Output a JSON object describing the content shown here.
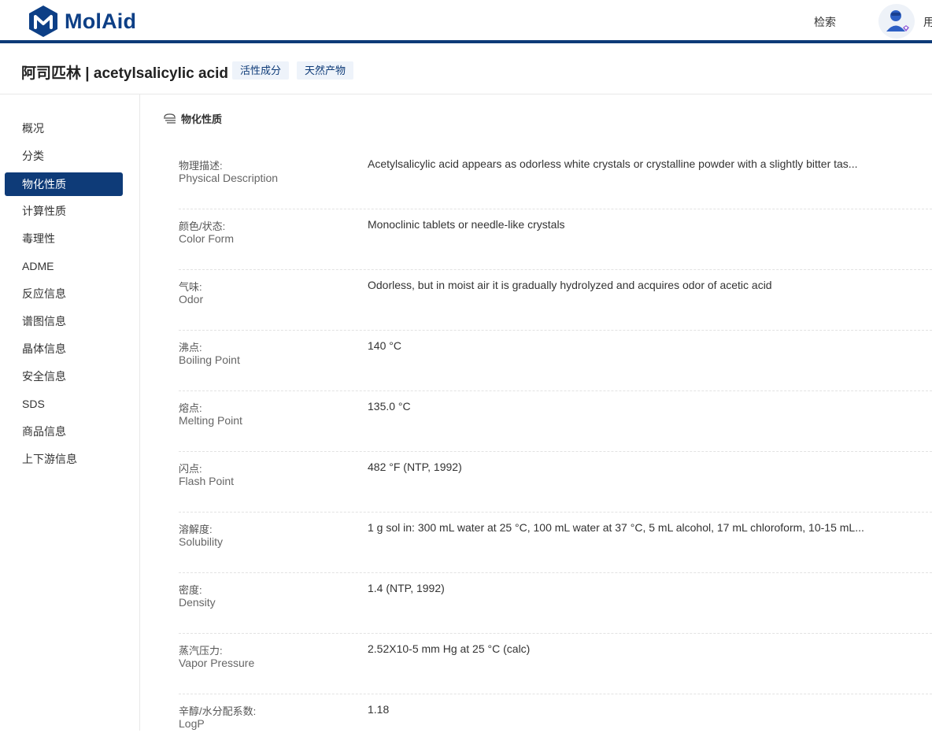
{
  "header": {
    "logo_text": "MolAid",
    "search_label": "检索",
    "user_label": "用"
  },
  "compound": {
    "title": "阿司匹林 | acetylsalicylic acid",
    "tags": [
      "活性成分",
      "天然产物"
    ]
  },
  "sidebar": {
    "items": [
      {
        "label": "概况"
      },
      {
        "label": "分类"
      },
      {
        "label": "物化性质",
        "active": true
      },
      {
        "label": "计算性质"
      },
      {
        "label": "毒理性"
      },
      {
        "label": "ADME"
      },
      {
        "label": "反应信息"
      },
      {
        "label": "谱图信息"
      },
      {
        "label": "晶体信息"
      },
      {
        "label": "安全信息"
      },
      {
        "label": "SDS"
      },
      {
        "label": "商品信息"
      },
      {
        "label": "上下游信息"
      }
    ]
  },
  "section": {
    "title": "物化性质"
  },
  "properties": [
    {
      "zh": "物理描述:",
      "en": "Physical Description",
      "value": "Acetylsalicylic acid appears as odorless white crystals or crystalline powder with a slightly bitter tas..."
    },
    {
      "zh": "颜色/状态:",
      "en": "Color Form",
      "value": "Monoclinic tablets or needle-like crystals"
    },
    {
      "zh": "气味:",
      "en": "Odor",
      "value": "Odorless, but in moist air it is gradually hydrolyzed and acquires odor of acetic acid"
    },
    {
      "zh": "沸点:",
      "en": "Boiling Point",
      "value": "140 °C"
    },
    {
      "zh": "熔点:",
      "en": "Melting Point",
      "value": "135.0 °C"
    },
    {
      "zh": "闪点:",
      "en": "Flash Point",
      "value": "482 °F (NTP, 1992)"
    },
    {
      "zh": "溶解度:",
      "en": "Solubility",
      "value": "1 g sol in: 300 mL water at 25 °C, 100 mL water at 37 °C, 5 mL alcohol, 17 mL chloroform, 10-15 mL..."
    },
    {
      "zh": "密度:",
      "en": "Density",
      "value": "1.4 (NTP, 1992)"
    },
    {
      "zh": "蒸汽压力:",
      "en": "Vapor Pressure",
      "value": "2.52X10-5 mm Hg at 25 °C (calc)"
    },
    {
      "zh": "辛醇/水分配系数:",
      "en": "LogP",
      "value": "1.18"
    }
  ],
  "colors": {
    "brand": "#0e3b78",
    "tag_bg": "#eef3fa"
  }
}
